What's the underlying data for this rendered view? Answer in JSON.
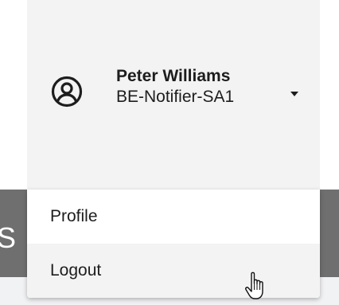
{
  "user": {
    "name": "Peter Williams",
    "account": "BE-Notifier-SA1",
    "avatar_icon": "user-circle-icon",
    "caret_icon": "caret-down-icon"
  },
  "background": {
    "partial_letter": "S"
  },
  "menu": {
    "items": [
      {
        "label": "Profile",
        "hovered": false
      },
      {
        "label": "Logout",
        "hovered": true
      }
    ]
  },
  "cursor": {
    "type": "hand-pointer-icon"
  },
  "colors": {
    "header_bg": "#f3f3f3",
    "menu_bg": "#ffffff",
    "hover_bg": "#f3f3f3",
    "page_dark_strip": "#6f6f6f",
    "page_light_strip": "#f1f2f4",
    "text": "#1d1d1d"
  }
}
